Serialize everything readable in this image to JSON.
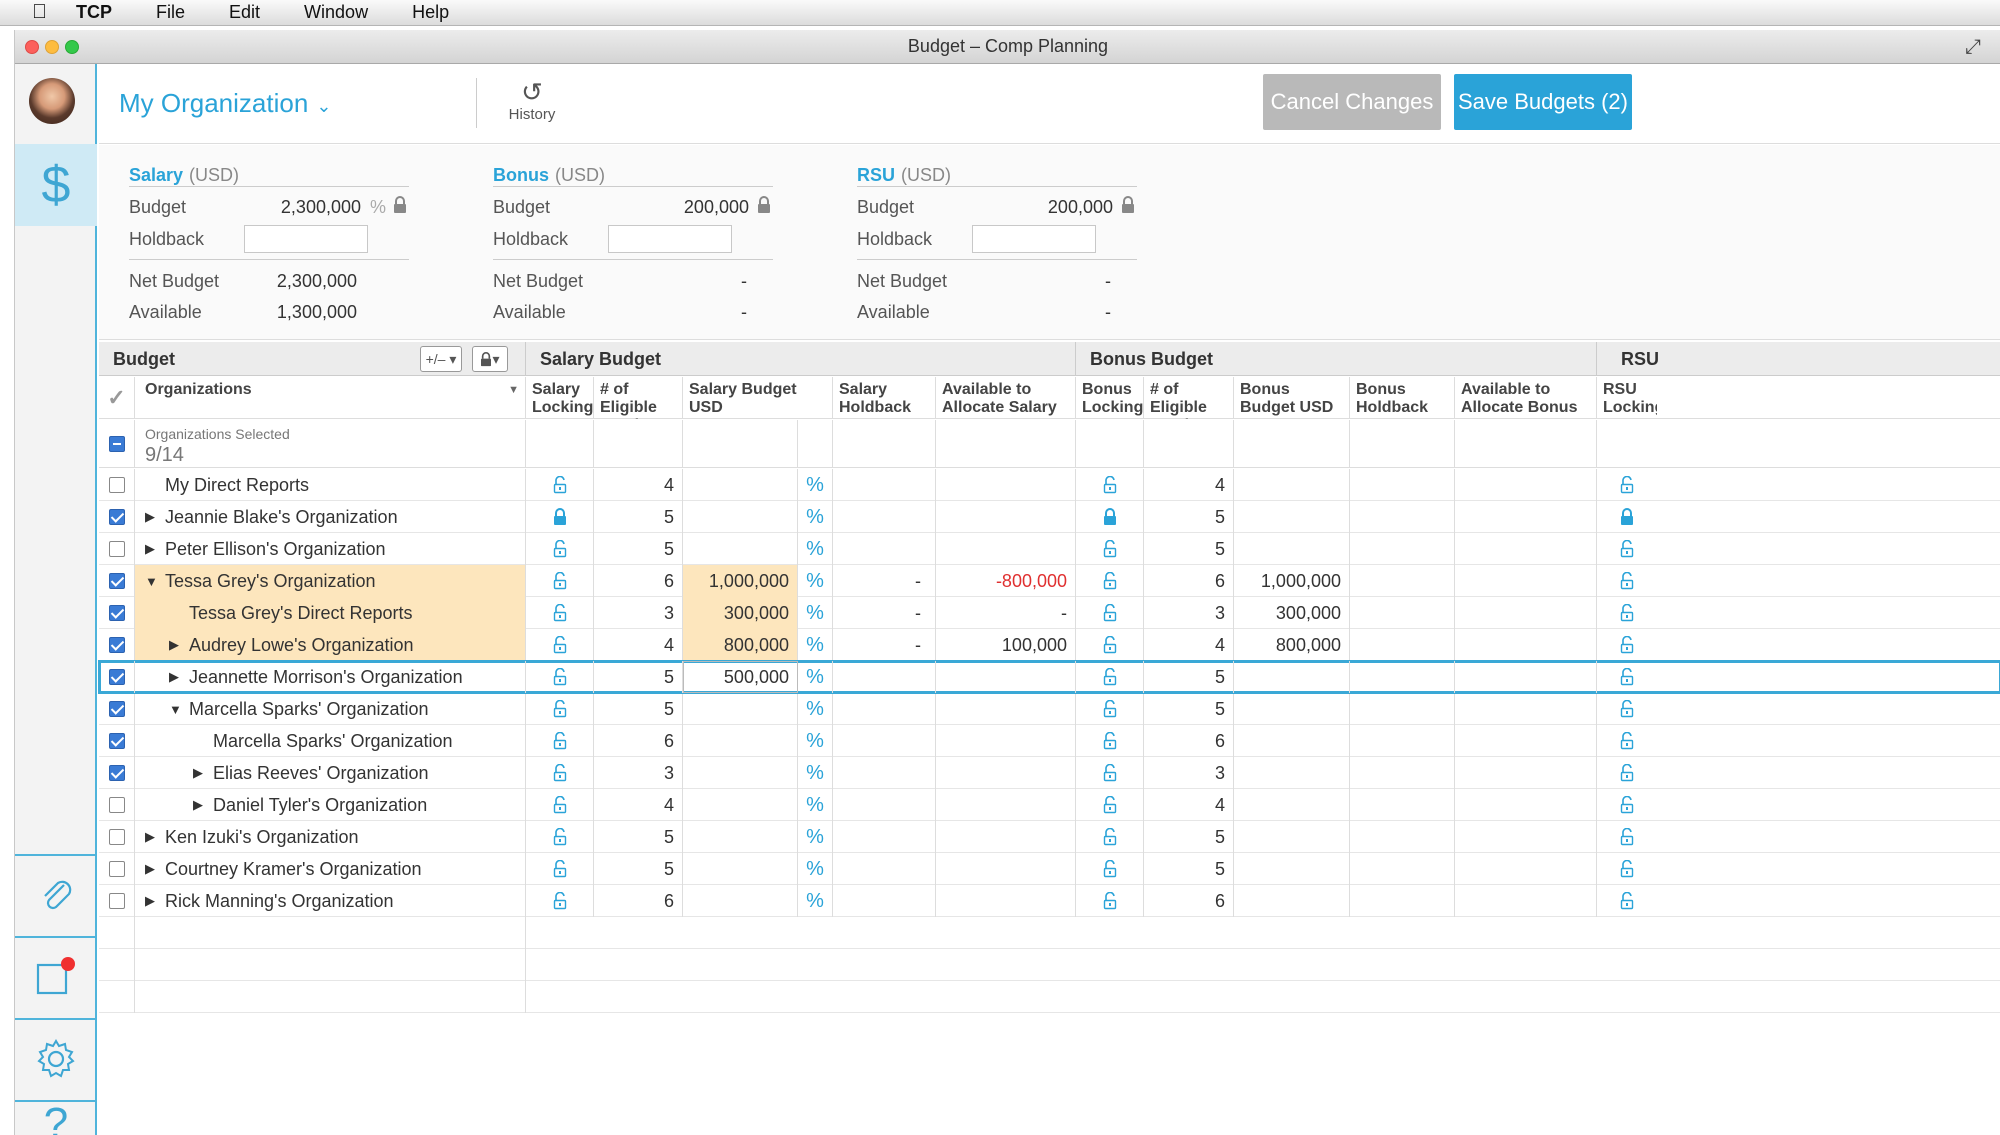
{
  "menubar": {
    "app": "TCP",
    "items": [
      "File",
      "Edit",
      "Window",
      "Help"
    ]
  },
  "window": {
    "title": "Budget – Comp Planning"
  },
  "header": {
    "org_title": "My Organization",
    "history_label": "History",
    "cancel_label": "Cancel Changes",
    "save_label": "Save Budgets (2)"
  },
  "summary": {
    "salary": {
      "name": "Salary",
      "currency": "(USD)",
      "budget_label": "Budget",
      "budget": "2,300,000",
      "pct": "%",
      "holdback_label": "Holdback",
      "net_label": "Net Budget",
      "net": "2,300,000",
      "available_label": "Available",
      "available": "1,300,000"
    },
    "bonus": {
      "name": "Bonus",
      "currency": "(USD)",
      "budget_label": "Budget",
      "budget": "200,000",
      "holdback_label": "Holdback",
      "net_label": "Net Budget",
      "net": "-",
      "available_label": "Available",
      "available": "-"
    },
    "rsu": {
      "name": "RSU",
      "currency": "(USD)",
      "budget_label": "Budget",
      "budget": "200,000",
      "holdback_label": "Holdback",
      "net_label": "Net Budget",
      "net": "-",
      "available_label": "Available",
      "available": "-"
    }
  },
  "grid": {
    "sections": {
      "budget": "Budget",
      "salary": "Salary Budget",
      "bonus": "Bonus Budget",
      "rsu": "RSU"
    },
    "plusminus": "+/– ▾",
    "columns": {
      "organizations": "Organizations",
      "salary_locking": "Salary Locking",
      "salary_eligible": "# of Eligible Employees",
      "salary_budget": "Salary Budget USD",
      "salary_holdback": "Salary Holdback USD",
      "salary_available": "Available to Allocate Salary USD",
      "bonus_locking": "Bonus Locking",
      "bonus_eligible": "# of Eligible Employees",
      "bonus_budget": "Bonus Budget USD",
      "bonus_holdback": "Bonus Holdback USD",
      "bonus_available": "Available to Allocate Bonus USD",
      "rsu_locking": "RSU Locking"
    },
    "selected_label": "Organizations Selected",
    "selected_count": "9/14",
    "pct_symbol": "%",
    "rows": [
      {
        "name": "My Direct Reports",
        "checked": false,
        "indent": 0,
        "tri": "",
        "sal_locked": false,
        "sal_elig": "4",
        "sal_budget": "",
        "sal_hold": "",
        "sal_avail": "",
        "bon_locked": false,
        "bon_elig": "4",
        "bon_budget": "",
        "rsu_locked": false,
        "hl": false
      },
      {
        "name": "Jeannie Blake's Organization",
        "checked": true,
        "indent": 0,
        "tri": "▶",
        "sal_locked": true,
        "sal_elig": "5",
        "sal_budget": "",
        "sal_hold": "",
        "sal_avail": "",
        "bon_locked": true,
        "bon_elig": "5",
        "bon_budget": "",
        "rsu_locked": true,
        "hl": false
      },
      {
        "name": "Peter Ellison's Organization",
        "checked": false,
        "indent": 0,
        "tri": "▶",
        "sal_locked": false,
        "sal_elig": "5",
        "sal_budget": "",
        "sal_hold": "",
        "sal_avail": "",
        "bon_locked": false,
        "bon_elig": "5",
        "bon_budget": "",
        "rsu_locked": false,
        "hl": false
      },
      {
        "name": "Tessa Grey's Organization",
        "checked": true,
        "indent": 0,
        "tri": "▼",
        "sal_locked": false,
        "sal_elig": "6",
        "sal_budget": "1,000,000",
        "sal_hold": "-",
        "sal_avail": "-800,000",
        "neg": true,
        "bon_locked": false,
        "bon_elig": "6",
        "bon_budget": "1,000,000",
        "rsu_locked": false,
        "hl": true
      },
      {
        "name": "Tessa Grey's Direct Reports",
        "checked": true,
        "indent": 1,
        "tri": "",
        "sal_locked": false,
        "sal_elig": "3",
        "sal_budget": "300,000",
        "sal_hold": "-",
        "sal_avail": "-",
        "bon_locked": false,
        "bon_elig": "3",
        "bon_budget": "300,000",
        "rsu_locked": false,
        "hl": true
      },
      {
        "name": "Audrey Lowe's Organization",
        "checked": true,
        "indent": 1,
        "tri": "▶",
        "sal_locked": false,
        "sal_elig": "4",
        "sal_budget": "800,000",
        "sal_hold": "-",
        "sal_avail": "100,000",
        "bon_locked": false,
        "bon_elig": "4",
        "bon_budget": "800,000",
        "rsu_locked": false,
        "hl": true
      },
      {
        "name": "Jeannette Morrison's Organization",
        "checked": true,
        "indent": 1,
        "tri": "▶",
        "sal_locked": false,
        "sal_elig": "5",
        "sal_budget": "500,000",
        "sal_hold": "",
        "sal_avail": "",
        "bon_locked": false,
        "bon_elig": "5",
        "bon_budget": "",
        "rsu_locked": false,
        "hl": false,
        "selected": true
      },
      {
        "name": "Marcella Sparks' Organization",
        "checked": true,
        "indent": 1,
        "tri": "▼",
        "sal_locked": false,
        "sal_elig": "5",
        "sal_budget": "",
        "sal_hold": "",
        "sal_avail": "",
        "bon_locked": false,
        "bon_elig": "5",
        "bon_budget": "",
        "rsu_locked": false,
        "hl": false
      },
      {
        "name": "Marcella Sparks' Organization",
        "checked": true,
        "indent": 2,
        "tri": "",
        "sal_locked": false,
        "sal_elig": "6",
        "sal_budget": "",
        "sal_hold": "",
        "sal_avail": "",
        "bon_locked": false,
        "bon_elig": "6",
        "bon_budget": "",
        "rsu_locked": false,
        "hl": false
      },
      {
        "name": "Elias Reeves' Organization",
        "checked": true,
        "indent": 2,
        "tri": "▶",
        "sal_locked": false,
        "sal_elig": "3",
        "sal_budget": "",
        "sal_hold": "",
        "sal_avail": "",
        "bon_locked": false,
        "bon_elig": "3",
        "bon_budget": "",
        "rsu_locked": false,
        "hl": false
      },
      {
        "name": "Daniel Tyler's Organization",
        "checked": false,
        "indent": 2,
        "tri": "▶",
        "sal_locked": false,
        "sal_elig": "4",
        "sal_budget": "",
        "sal_hold": "",
        "sal_avail": "",
        "bon_locked": false,
        "bon_elig": "4",
        "bon_budget": "",
        "rsu_locked": false,
        "hl": false
      },
      {
        "name": "Ken Izuki's Organization",
        "checked": false,
        "indent": 0,
        "tri": "▶",
        "sal_locked": false,
        "sal_elig": "5",
        "sal_budget": "",
        "sal_hold": "",
        "sal_avail": "",
        "bon_locked": false,
        "bon_elig": "5",
        "bon_budget": "",
        "rsu_locked": false,
        "hl": false
      },
      {
        "name": "Courtney Kramer's Organization",
        "checked": false,
        "indent": 0,
        "tri": "▶",
        "sal_locked": false,
        "sal_elig": "5",
        "sal_budget": "",
        "sal_hold": "",
        "sal_avail": "",
        "bon_locked": false,
        "bon_elig": "5",
        "bon_budget": "",
        "rsu_locked": false,
        "hl": false
      },
      {
        "name": "Rick Manning's Organization",
        "checked": false,
        "indent": 0,
        "tri": "▶",
        "sal_locked": false,
        "sal_elig": "6",
        "sal_budget": "",
        "sal_hold": "",
        "sal_avail": "",
        "bon_locked": false,
        "bon_elig": "6",
        "bon_budget": "",
        "rsu_locked": false,
        "hl": false
      }
    ]
  },
  "colors": {
    "accent": "#2aa3d8",
    "highlight": "#fde6bd",
    "negative": "#e03030",
    "cancel": "#b9b9b9"
  }
}
